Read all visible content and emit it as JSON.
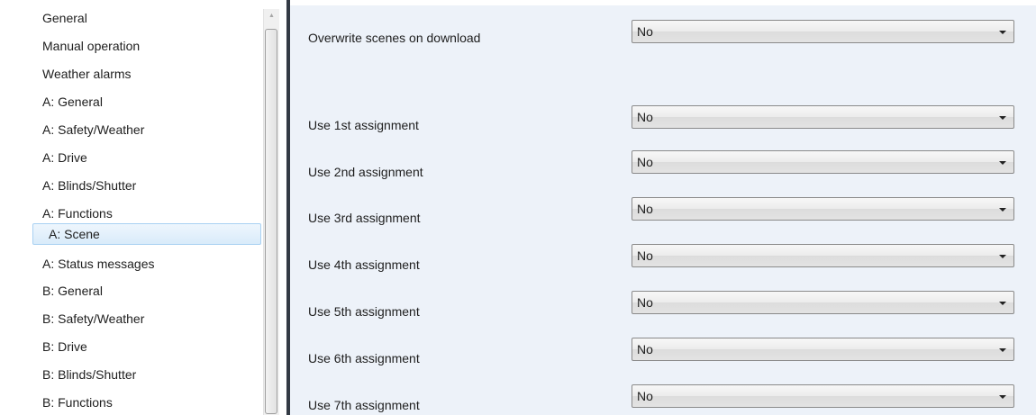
{
  "nav": {
    "items": [
      {
        "label": "General",
        "selected": false
      },
      {
        "label": "Manual operation",
        "selected": false
      },
      {
        "label": "Weather alarms",
        "selected": false
      },
      {
        "label": "A: General",
        "selected": false
      },
      {
        "label": "A: Safety/Weather",
        "selected": false
      },
      {
        "label": "A: Drive",
        "selected": false
      },
      {
        "label": "A: Blinds/Shutter",
        "selected": false
      },
      {
        "label": "A: Functions",
        "selected": false
      },
      {
        "label": "A: Scene",
        "selected": true
      },
      {
        "label": "A: Status messages",
        "selected": false
      },
      {
        "label": "B: General",
        "selected": false
      },
      {
        "label": "B: Safety/Weather",
        "selected": false
      },
      {
        "label": "B: Drive",
        "selected": false
      },
      {
        "label": "B: Blinds/Shutter",
        "selected": false
      },
      {
        "label": "B: Functions",
        "selected": false
      }
    ]
  },
  "panel": {
    "params": [
      {
        "label": "Overwrite scenes on download",
        "value": "No"
      },
      {
        "label": "Use 1st assignment",
        "value": "No"
      },
      {
        "label": "Use 2nd assignment",
        "value": "No"
      },
      {
        "label": "Use 3rd assignment",
        "value": "No"
      },
      {
        "label": "Use 4th assignment",
        "value": "No"
      },
      {
        "label": "Use 5th assignment",
        "value": "No"
      },
      {
        "label": "Use 6th assignment",
        "value": "No"
      },
      {
        "label": "Use 7th assignment",
        "value": "No"
      }
    ]
  },
  "colors": {
    "panel_bg": "#edf2f9",
    "selection": "#d9ebfa",
    "divider": "#333a44"
  }
}
